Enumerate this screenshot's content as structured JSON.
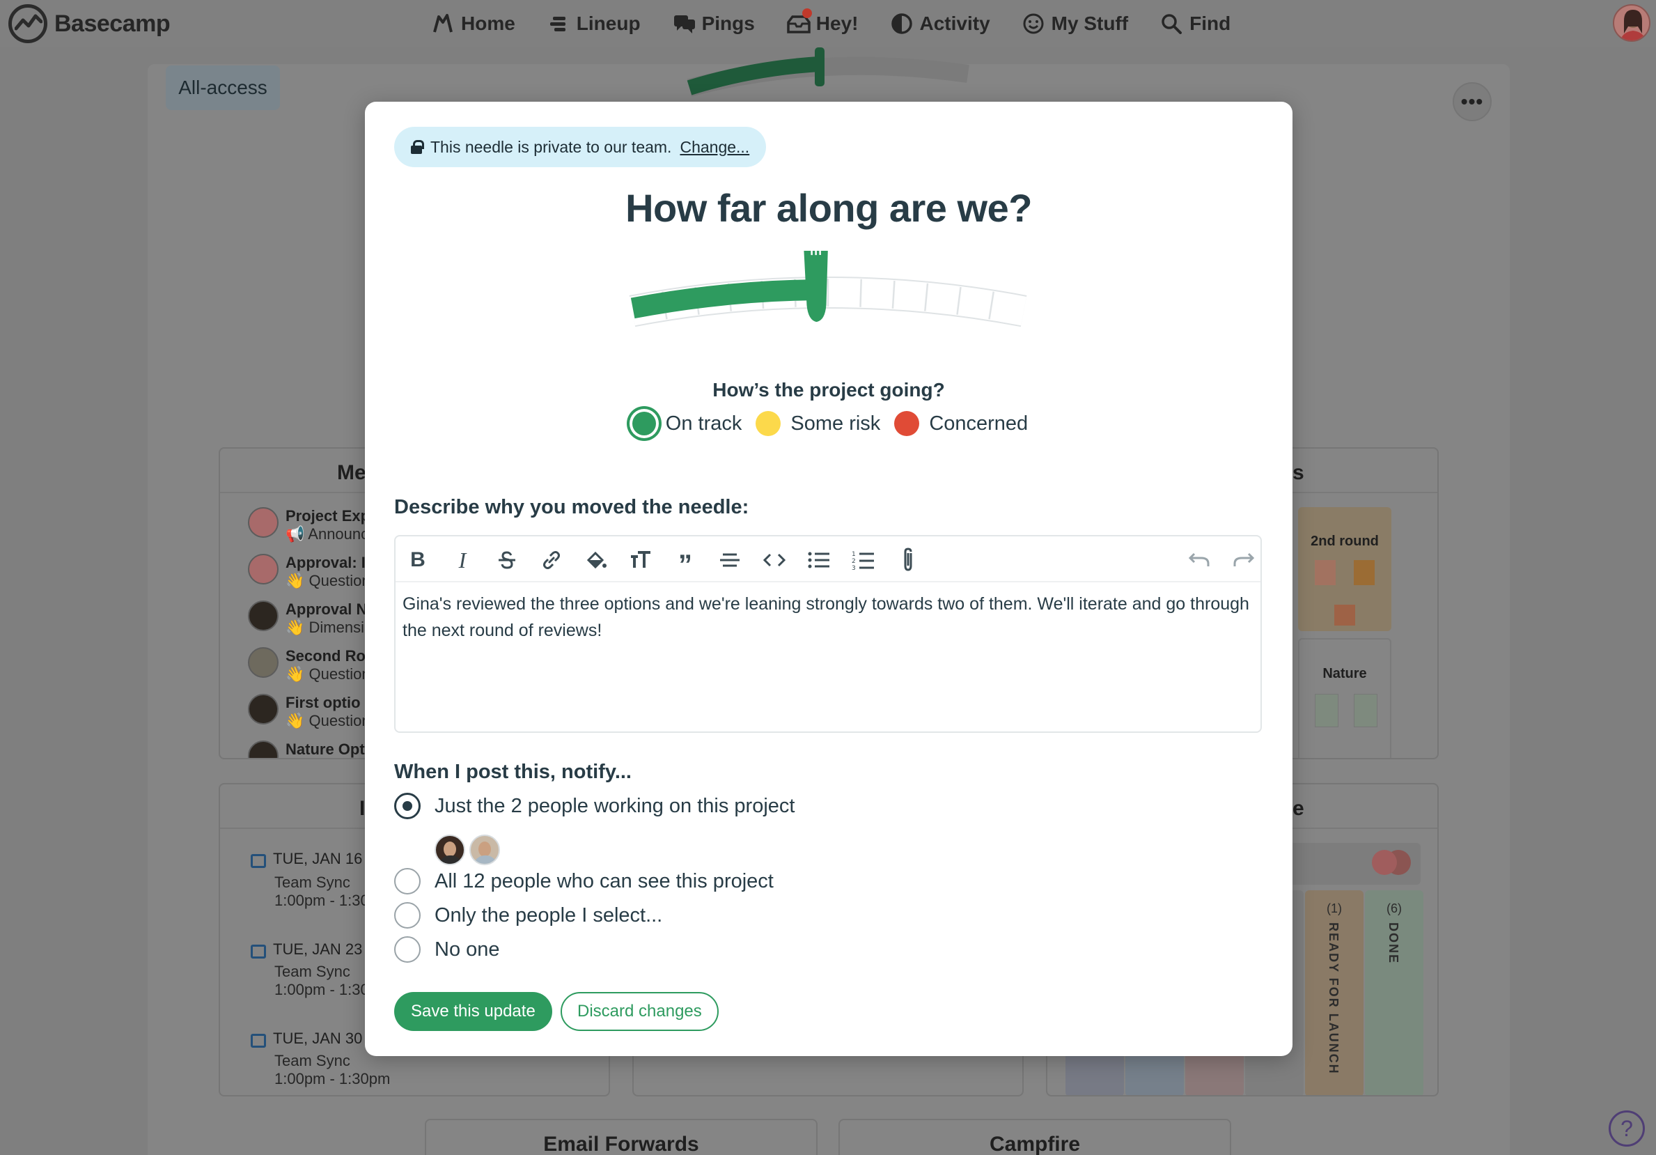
{
  "app": {
    "name": "Basecamp"
  },
  "nav": {
    "items": [
      {
        "label": "Home",
        "icon": "home-icon"
      },
      {
        "label": "Lineup",
        "icon": "lineup-icon"
      },
      {
        "label": "Pings",
        "icon": "pings-icon"
      },
      {
        "label": "Hey!",
        "icon": "hey-icon"
      },
      {
        "label": "Activity",
        "icon": "activity-icon"
      },
      {
        "label": "My Stuff",
        "icon": "my-stuff-icon"
      },
      {
        "label": "Find",
        "icon": "search-icon"
      }
    ]
  },
  "background": {
    "all_access": "All-access",
    "message_board": {
      "title_partial": "Me",
      "items": [
        {
          "title": "Project Exp",
          "sub": "📢 Announc"
        },
        {
          "title": "Approval: I",
          "sub": "👋 Question"
        },
        {
          "title": "Approval N",
          "sub": "👋 Dimensi"
        },
        {
          "title": "Second Ro",
          "sub": "👋 Question"
        },
        {
          "title": "First optio",
          "sub": "👋 Question"
        },
        {
          "title": "Nature Opt",
          "sub": ""
        }
      ]
    },
    "docs_partial": "s",
    "docs": [
      {
        "label": "2nd round"
      },
      {
        "label": "Nature"
      }
    ],
    "schedule": {
      "title_partial": "I",
      "items": [
        {
          "date": "TUE, JAN 16",
          "title": "Team Sync",
          "time": "1:00pm - 1:30"
        },
        {
          "date": "TUE, JAN 23",
          "title": "Team Sync",
          "time": "1:00pm - 1:30"
        },
        {
          "date": "TUE, JAN 30",
          "title": "Team Sync",
          "time": "1:00pm - 1:30pm"
        }
      ]
    },
    "card_table": {
      "title_partial": "e",
      "columns": [
        {
          "count": "(1)",
          "label": "READY FOR LAUNCH",
          "color": "#8a7a66"
        },
        {
          "count": "(6)",
          "label": "DONE",
          "color": "#7a8a7e"
        }
      ]
    },
    "email_forwards": "Email Forwards",
    "campfire": "Campfire",
    "help": "?"
  },
  "modal": {
    "privacy_text": "This needle is private to our team.",
    "privacy_link": "Change...",
    "title": "How far along are we?",
    "progress_fraction": 0.47,
    "status_question": "How’s the project going?",
    "statuses": [
      {
        "label": "On track",
        "color": "#2e9b5f",
        "selected": true
      },
      {
        "label": "Some risk",
        "color": "#fcd94b",
        "selected": false
      },
      {
        "label": "Concerned",
        "color": "#e04b36",
        "selected": false
      }
    ],
    "describe_label": "Describe why you moved the needle:",
    "editor_text": "Gina's reviewed the three options and we're leaning strongly towards two of them. We'll iterate and go through the next round of reviews!",
    "notify_label": "When I post this, notify...",
    "notify_options": [
      {
        "label": "Just the 2 people working on this project",
        "selected": true
      },
      {
        "label": "All 12 people who can see this project",
        "selected": false
      },
      {
        "label": "Only the people I select...",
        "selected": false
      },
      {
        "label": "No one",
        "selected": false
      }
    ],
    "save_label": "Save this update",
    "discard_label": "Discard changes"
  },
  "colors": {
    "accent": "#2e9b5f",
    "heading": "#283c46",
    "privacy_bg": "#d6f0f9"
  }
}
